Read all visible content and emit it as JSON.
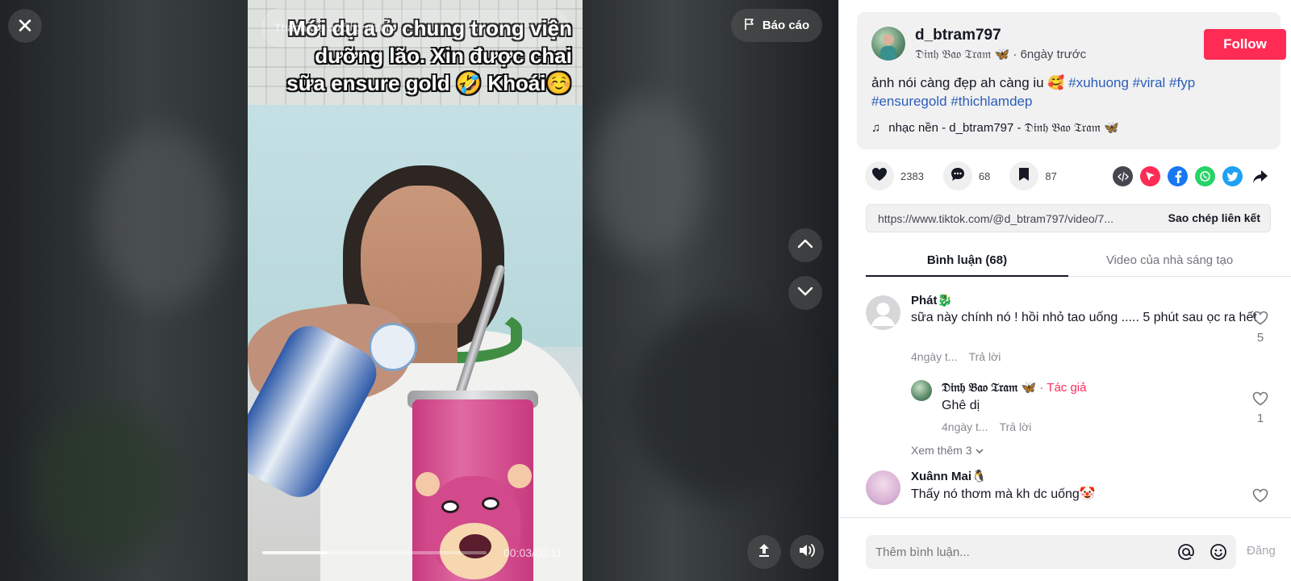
{
  "video": {
    "caption_lines": [
      "Mới dụ a ở chung trong viện",
      "dưỡng lão. Xin được chai",
      "sữa ensure gold 🤣 Khoái☺️"
    ],
    "overlay_text": "Thành gia dưỡng nhiệp",
    "current_time": "00:03",
    "duration": "00:11",
    "time_display": "00:03/00:11",
    "progress": 0.29,
    "report_label": "Báo cáo",
    "icons": {
      "close": "close-icon",
      "report": "flag-icon",
      "prev": "chevron-up-icon",
      "next": "chevron-down-icon",
      "autoscroll": "autoscroll-icon",
      "volume": "volume-icon"
    }
  },
  "post": {
    "username": "d_btram797",
    "nickname": "𝔇𝔦𝔫𝔥 𝔅𝔞𝔬 𝔗𝔯𝔞𝔪 🦋",
    "date": "6ngày trước",
    "follow_label": "Follow",
    "description_text": "ảnh nói càng đẹp ah càng iu 🥰",
    "hashtags_line1": [
      "#xuhuong",
      "#viral",
      "#fyp"
    ],
    "hashtags_line2": [
      "#ensuregold",
      "#thichlamdep"
    ],
    "music_label": "nhạc nền - d_btram797 - 𝔇𝔦𝔫𝔥 𝔅𝔞𝔬 𝔗𝔯𝔞𝔪 🦋"
  },
  "stats": {
    "likes": "2383",
    "comments": "68",
    "saves": "87"
  },
  "share": {
    "url": "https://www.tiktok.com/@d_btram797/video/7...",
    "copy_label": "Sao chép liên kết",
    "icons": [
      "embed-icon",
      "send-icon",
      "facebook-icon",
      "whatsapp-icon",
      "twitter-icon",
      "share-arrow-icon"
    ],
    "colors": {
      "embed": "#454650",
      "send": "#fe2c55",
      "facebook": "#1877f2",
      "whatsapp": "#25d366",
      "twitter": "#1da1f2"
    }
  },
  "tabs": {
    "comments": "Bình luận (68)",
    "creator_videos": "Video của nhà sáng tạo"
  },
  "comments": [
    {
      "name": "Phát🐉",
      "text": "sữa này chính nó ! hồi nhỏ tao uống ..... 5 phút sau ọc ra hết",
      "date": "4ngày t...",
      "reply_label": "Trả lời",
      "likes": "5"
    },
    {
      "name": "𝔇𝔦𝔫𝔥 𝔅𝔞𝔬 𝔗𝔯𝔞𝔪 🦋",
      "author_tag": "· Tác giả",
      "text": "Ghê dị",
      "date": "4ngày t...",
      "reply_label": "Trả lời",
      "likes": "1"
    },
    {
      "name": "Xuânn Mai🐧",
      "text": "Thấy nó thơm mà kh dc uống🤡",
      "likes": ""
    }
  ],
  "more_replies": "Xem thêm 3",
  "comment_input": {
    "placeholder": "Thêm bình luận...",
    "post_label": "Đăng"
  }
}
